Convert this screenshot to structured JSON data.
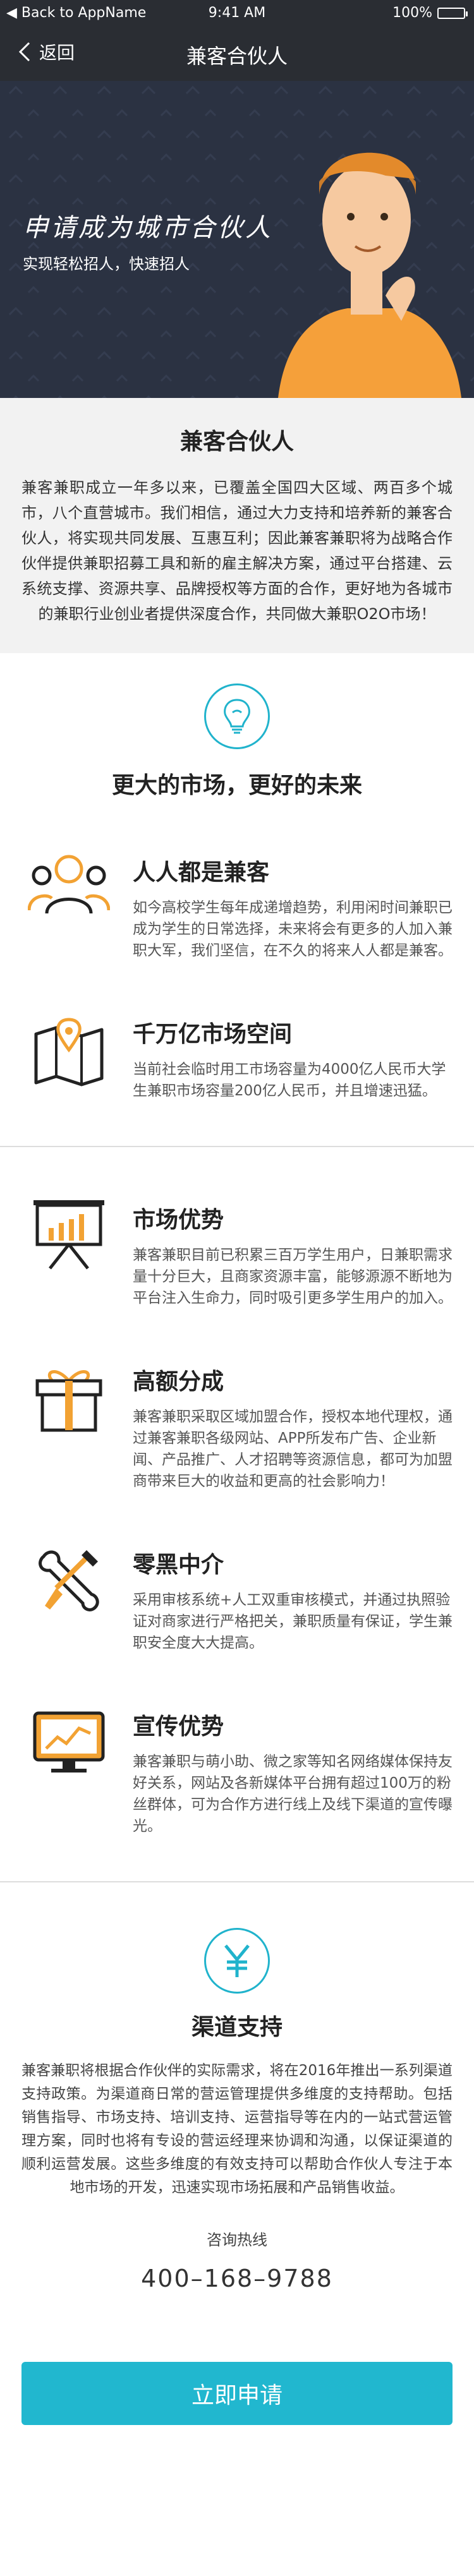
{
  "status_bar": {
    "back_app": "Back to AppName",
    "time": "9:41 AM",
    "battery": "100%"
  },
  "nav": {
    "back_label": "返回",
    "title": "兼客合伙人"
  },
  "banner": {
    "slogan": "申请成为城市合伙人",
    "subtitle": "实现轻松招人，快速招人"
  },
  "intro": {
    "title": "兼客合伙人",
    "body": "兼客兼职成立一年多以来，已覆盖全国四大区域、两百多个城市，八个直营城市。我们相信，通过大力支持和培养新的兼客合伙人，将实现共同发展、互惠互利；因此兼客兼职将为战略合作伙伴提供兼职招募工具和新的雇主解决方案，通过平台搭建、云系统支撑、资源共享、品牌授权等方面的合作，更好地为各城市的兼职行业创业者提供深度合作，共同做大兼职O2O市场！"
  },
  "market": {
    "heading": "更大的市场，更好的未来",
    "features": [
      {
        "title": "人人都是兼客",
        "body": "如今高校学生每年成递增趋势，利用闲时间兼职已成为学生的日常选择，未来将会有更多的人加入兼职大军，我们坚信，在不久的将来人人都是兼客。"
      },
      {
        "title": "千万亿市场空间",
        "body": "当前社会临时用工市场容量为4000亿人民币大学生兼职市场容量200亿人民币，并且增速迅猛。"
      },
      {
        "title": "市场优势",
        "body": "兼客兼职目前已积累三百万学生用户，日兼职需求量十分巨大，且商家资源丰富，能够源源不断地为平台注入生命力，同时吸引更多学生用户的加入。"
      },
      {
        "title": "高额分成",
        "body": "兼客兼职采取区域加盟合作，授权本地代理权，通过兼客兼职各级网站、APP所发布广告、企业新闻、产品推广、人才招聘等资源信息，都可为加盟商带来巨大的收益和更高的社会影响力！"
      },
      {
        "title": "零黑中介",
        "body": "采用审核系统+人工双重审核模式，并通过执照验证对商家进行严格把关，兼职质量有保证，学生兼职安全度大大提高。"
      },
      {
        "title": "宣传优势",
        "body": "兼客兼职与萌小助、微之家等知名网络媒体保持友好关系，网站及各新媒体平台拥有超过100万的粉丝群体，可为合作方进行线上及线下渠道的宣传曝光。"
      }
    ]
  },
  "channel": {
    "title": "渠道支持",
    "body": "兼客兼职将根据合作伙伴的实际需求，将在2016年推出一系列渠道支持政策。为渠道商日常的营运管理提供多维度的支持帮助。包括销售指导、市场支持、培训支持、运营指导等在内的一站式营运管理方案，同时也将有专设的营运经理来协调和沟通，以保证渠道的顺利运营发展。这些多维度的有效支持可以帮助合作伙人专注于本地市场的开发，迅速实现市场拓展和产品销售收益。",
    "hotline_label": "咨询热线",
    "hotline_number": "400–168–9788"
  },
  "apply_button": "立即申请",
  "colors": {
    "accent": "#21b7cf",
    "icon_orange": "#f2a233",
    "banner_bg": "#2b3242",
    "nav_bg": "#2a2d33"
  }
}
